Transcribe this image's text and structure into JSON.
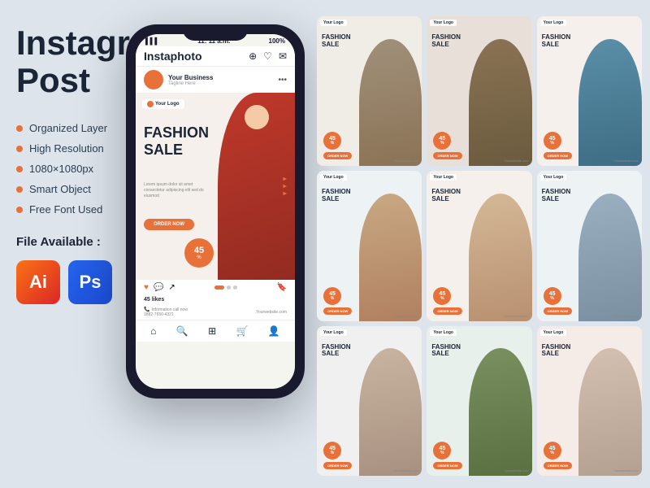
{
  "title": "Instagram Post",
  "left": {
    "heading_line1": "Instagram",
    "heading_line2": "Post",
    "features": [
      {
        "label": "Organized Layer"
      },
      {
        "label": "High Resolution"
      },
      {
        "label": "1080×1080px"
      },
      {
        "label": "Smart Object"
      },
      {
        "label": "Free Font Used"
      }
    ],
    "file_available": "File Available :",
    "icons": [
      {
        "name": "Ai",
        "type": "ai"
      },
      {
        "name": "Ps",
        "type": "ps"
      }
    ]
  },
  "phone": {
    "status": {
      "signal": "▌▌▌",
      "time": "11: 11 a.m.",
      "battery": "100%"
    },
    "app_name": "Instaphoto",
    "profile_name": "Your Business",
    "profile_tagline": "Tagline Here",
    "your_logo": "Your Logo",
    "fashion": "FASHION",
    "sale": "SALE",
    "lorem_text": "Lorem ipsum dolor sit amet consectetur adipiscing elit sed do eiusmod",
    "order_now": "ORDER NOW",
    "percent": "45",
    "percent_sign": "%",
    "likes": "45 likes",
    "info_phone": "Information call now",
    "info_number": "1882-7650-4321",
    "website": "Yourwebsite.com",
    "nav_icons": [
      "⌂",
      "🔍",
      "⊞",
      "🛍",
      "👤"
    ]
  },
  "grid": {
    "items": [
      {
        "label": "FASHION SALE",
        "logo": "Your Logo"
      },
      {
        "label": "FASHION SALE",
        "logo": "Your Logo"
      },
      {
        "label": "FASHION SALE",
        "logo": "Your Logo"
      },
      {
        "label": "FASHION SALE",
        "logo": "Your Logo"
      },
      {
        "label": "FASHION SALE",
        "logo": "Your Logo"
      },
      {
        "label": "FASHION SALE",
        "logo": "Your Logo"
      },
      {
        "label": "FASHION SALE",
        "logo": "Your Logo"
      },
      {
        "label": "FASHION SALE",
        "logo": "Your Logo"
      },
      {
        "label": "FASHION SALE",
        "logo": "Your Logo"
      }
    ],
    "badge_text": "45",
    "badge_sub": "%",
    "order_now": "ORDER NOW"
  },
  "colors": {
    "accent": "#e8713a",
    "dark": "#1a2535",
    "bg": "#dde4ec"
  }
}
